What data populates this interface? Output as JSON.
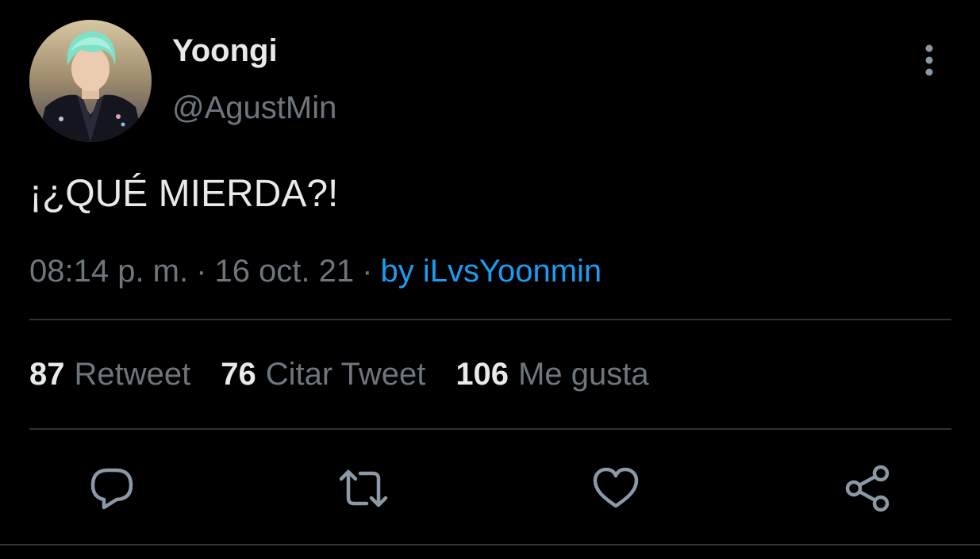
{
  "tweet": {
    "display_name": "Yoongi",
    "handle": "@AgustMin",
    "text": "¡¿QUÉ MIERDA?!",
    "time": "08:14 p. m.",
    "dot": "·",
    "date": "16 oct. 21",
    "source": "by iLvsYoonmin"
  },
  "stats": {
    "retweets": {
      "count": "87",
      "label": "Retweet"
    },
    "quotes": {
      "count": "76",
      "label": "Citar Tweet"
    },
    "likes": {
      "count": "106",
      "label": "Me gusta"
    }
  },
  "icons": {
    "more": "more-vertical-icon",
    "reply": "reply-icon",
    "retweet": "retweet-icon",
    "like": "heart-icon",
    "share": "share-icon"
  },
  "colors": {
    "background": "#000000",
    "primary_text": "#e7e9ea",
    "secondary_text": "#6e767d",
    "accent": "#1d9bf0",
    "divider": "#2f3336"
  }
}
